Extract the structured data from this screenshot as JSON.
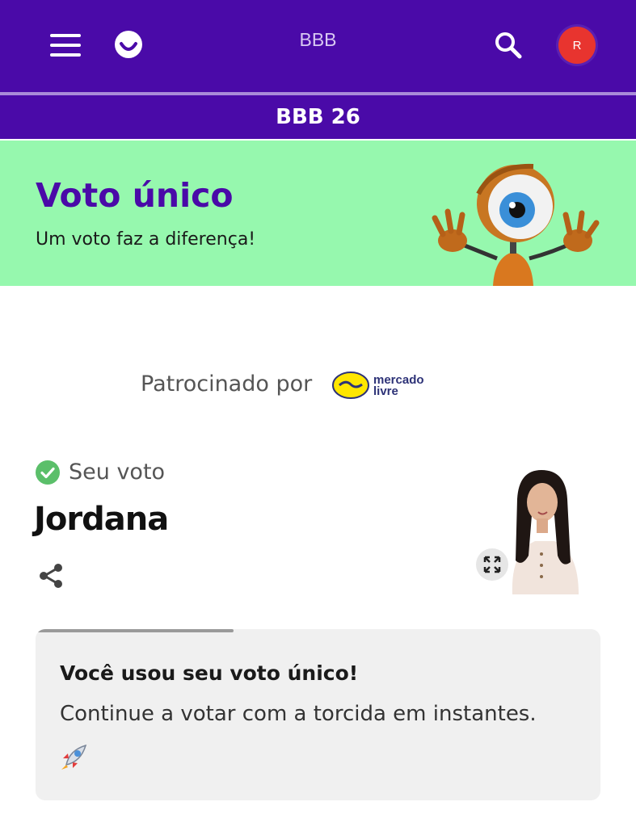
{
  "header": {
    "title": "BBB",
    "avatar_initial": "R",
    "icons": [
      "menu-icon",
      "smile-logo-icon",
      "search-icon"
    ]
  },
  "subnav": {
    "label": "BBB 26"
  },
  "banner": {
    "title": "Voto único",
    "subtitle": "Um voto faz a diferença!",
    "background": "#96f8ae",
    "title_color": "#4a0aa8"
  },
  "sponsor": {
    "label": "Patrocinado por",
    "logo_text_1": "mercado",
    "logo_text_2": "livre"
  },
  "vote": {
    "status_label": "Seu voto",
    "candidate": "Jordana"
  },
  "message": {
    "title": "Você usou seu voto único!",
    "body": "Continue a votar com a torcida em instantes.",
    "emoji": "rocket-emoji",
    "progress": 0.35
  },
  "colors": {
    "brand_purple": "#4a0aa8",
    "avatar_red": "#e8342f",
    "check_green": "#5bbf6a"
  }
}
